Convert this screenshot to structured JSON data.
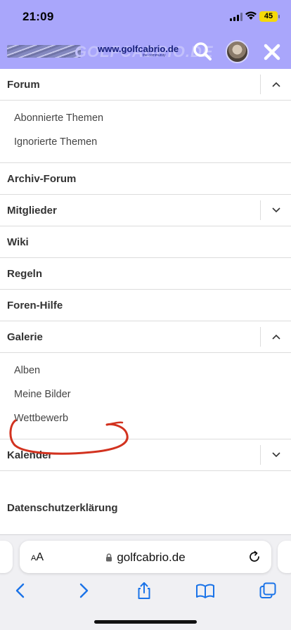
{
  "status_bar": {
    "time": "21:09",
    "battery": "45"
  },
  "header": {
    "logo_bg_text": "GOLFCABRIO.DE",
    "logo_text": "www.golfcabrio.de",
    "logo_sub": "the community",
    "icons": {
      "search": "search-icon",
      "avatar": "user-avatar",
      "close": "close-icon"
    },
    "accent": "#a9a6fb"
  },
  "menu": {
    "forum": {
      "label": "Forum",
      "sub": [
        "Abonnierte Themen",
        "Ignorierte Themen"
      ]
    },
    "archiv": {
      "label": "Archiv-Forum"
    },
    "mitglieder": {
      "label": "Mitglieder"
    },
    "wiki": {
      "label": "Wiki"
    },
    "regeln": {
      "label": "Regeln"
    },
    "hilfe": {
      "label": "Foren-Hilfe"
    },
    "galerie": {
      "label": "Galerie",
      "sub": [
        "Alben",
        "Meine Bilder",
        "Wettbewerb"
      ]
    },
    "kalender": {
      "label": "Kalender"
    },
    "datenschutz": {
      "label": "Datenschutzerklärung"
    }
  },
  "annotation": {
    "color": "#d2321f",
    "target": "Wettbewerb"
  },
  "safari": {
    "aa_small": "A",
    "aa_large": "A",
    "url": "golfcabrio.de",
    "toolbar": [
      "back-icon",
      "forward-icon",
      "share-icon",
      "bookmarks-icon",
      "tabs-icon"
    ]
  }
}
